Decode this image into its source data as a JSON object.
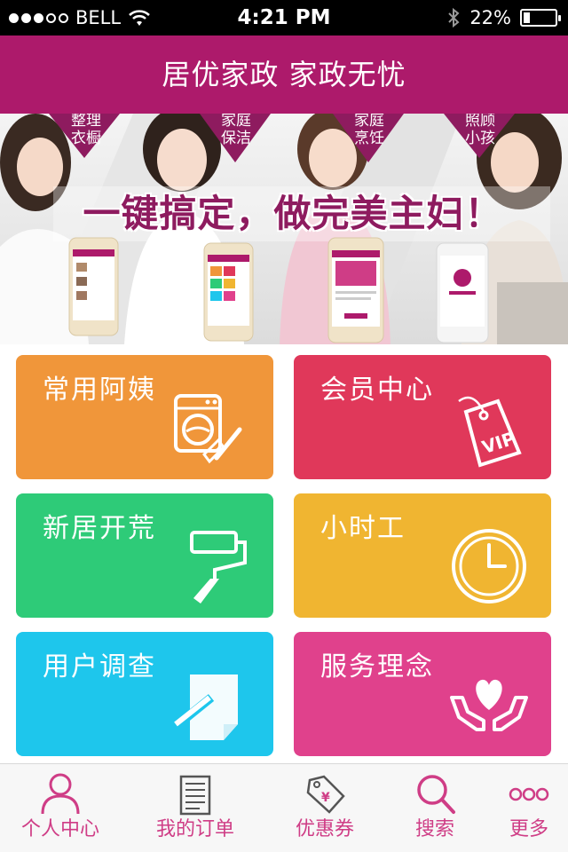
{
  "status_bar": {
    "carrier": "BELL",
    "time": "4:21 PM",
    "battery_percent": "22%",
    "battery_level": 0.22,
    "signal_bars_filled": 3,
    "signal_bars_total": 5
  },
  "header": {
    "title": "居优家政 家政无忧",
    "color": "#ad1a6b"
  },
  "banner": {
    "headline": "一键搞定，做完美主妇！",
    "tags": [
      "整理衣橱",
      "家庭保洁",
      "家庭烹饪",
      "照顾小孩"
    ],
    "accent": "#8e1b5f"
  },
  "tiles": [
    {
      "label": "常用阿姨",
      "color": "#f0963a",
      "icon": "washing-machine-icon"
    },
    {
      "label": "会员中心",
      "color": "#e0385a",
      "icon": "vip-tag-icon"
    },
    {
      "label": "新居开荒",
      "color": "#2ecb78",
      "icon": "paint-roller-icon"
    },
    {
      "label": "小时工",
      "color": "#f0b531",
      "icon": "clock-icon"
    },
    {
      "label": "用户调查",
      "color": "#1ec6ec",
      "icon": "note-pencil-icon"
    },
    {
      "label": "服务理念",
      "color": "#e0418c",
      "icon": "heart-hands-icon"
    }
  ],
  "tab_bar": {
    "items": [
      {
        "label": "个人中心",
        "icon": "person-icon"
      },
      {
        "label": "我的订单",
        "icon": "document-icon"
      },
      {
        "label": "优惠券",
        "icon": "coupon-tag-icon"
      },
      {
        "label": "搜索",
        "icon": "search-icon"
      },
      {
        "label": "更多",
        "icon": "more-dots-icon"
      }
    ],
    "tint": "#cf3d86"
  }
}
